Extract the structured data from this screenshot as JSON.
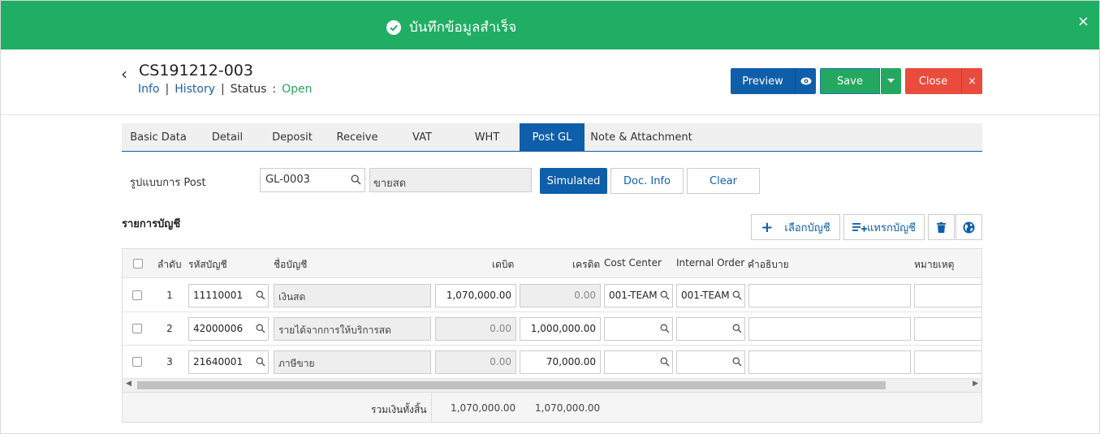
{
  "toast": {
    "message": "บันทึกข้อมูลสำเร็จ",
    "close": "×"
  },
  "header": {
    "title": "CS191212-003",
    "links": {
      "info": "Info",
      "history": "History",
      "status_label": "Status",
      "status_sep": ":",
      "status_value": "Open",
      "sep": "|"
    }
  },
  "buttons": {
    "preview": "Preview",
    "save": "Save",
    "close": "Close",
    "close_x": "×"
  },
  "tabs": [
    {
      "label": "Basic Data",
      "active": false
    },
    {
      "label": "Detail",
      "active": false
    },
    {
      "label": "Deposit",
      "active": false
    },
    {
      "label": "Receive",
      "active": false
    },
    {
      "label": "VAT",
      "active": false
    },
    {
      "label": "WHT",
      "active": false
    },
    {
      "label": "Post GL",
      "active": true
    },
    {
      "label": "Note & Attachment",
      "active": false
    }
  ],
  "post": {
    "label": "รูปแบบการ Post",
    "code": "GL-0003",
    "name": "ขายสด",
    "simulated": "Simulated",
    "doc_info": "Doc. Info",
    "clear": "Clear"
  },
  "section": {
    "title": "รายการบัญชี",
    "select_account": "เลือกบัญชี",
    "insert_account": "แทรกบัญชี"
  },
  "grid": {
    "headers": {
      "no": "ลำดับ",
      "code": "รหัสบัญชี",
      "name": "ชื่อบัญชี",
      "debit": "เดบิต",
      "credit": "เครดิต",
      "cost_center": "Cost Center",
      "internal_order": "Internal Order",
      "description": "คำอธิบาย",
      "remark": "หมายเหตุ"
    },
    "rows": [
      {
        "no": "1",
        "code": "11110001",
        "name": "เงินสด",
        "debit": "1,070,000.00",
        "credit": "0.00",
        "cost_center": "001-TEAM",
        "internal_order": "001-TEAM",
        "description": "",
        "remark": ""
      },
      {
        "no": "2",
        "code": "42000006",
        "name": "รายได้จากการให้บริการสด",
        "debit": "0.00",
        "credit": "1,000,000.00",
        "cost_center": "",
        "internal_order": "",
        "description": "",
        "remark": ""
      },
      {
        "no": "3",
        "code": "21640001",
        "name": "ภาษีขาย",
        "debit": "0.00",
        "credit": "70,000.00",
        "cost_center": "",
        "internal_order": "",
        "description": "",
        "remark": ""
      }
    ],
    "footer": {
      "label": "รวมเงินทั้งสิ้น",
      "debit_total": "1,070,000.00",
      "credit_total": "1,070,000.00"
    }
  },
  "colors": {
    "primary": "#0f5ea9",
    "success": "#24a860",
    "danger": "#e94b3c",
    "toast": "#1fae63"
  }
}
